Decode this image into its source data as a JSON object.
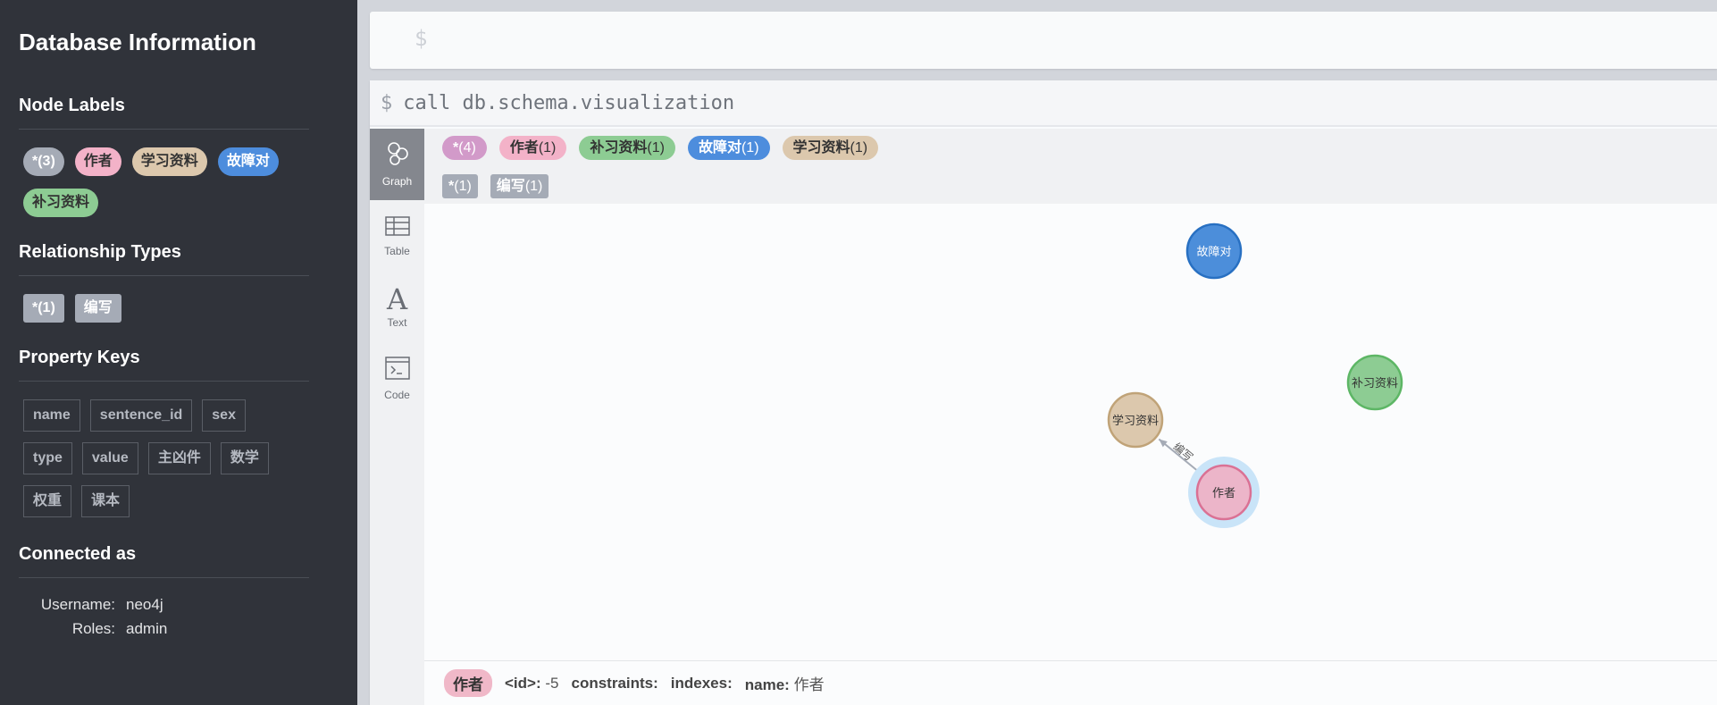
{
  "sidebar": {
    "title": "Database Information",
    "node_labels_title": "Node Labels",
    "node_labels": [
      {
        "label": "*(3)",
        "bg": "#a5abb6",
        "fg": "#ffffff"
      },
      {
        "label": "作者",
        "bg": "#f3b2c8",
        "fg": "#333333"
      },
      {
        "label": "学习资料",
        "bg": "#dcc8ad",
        "fg": "#333333"
      },
      {
        "label": "故障对",
        "bg": "#4d8ddd",
        "fg": "#ffffff"
      },
      {
        "label": "补习资料",
        "bg": "#8dcc93",
        "fg": "#333333"
      }
    ],
    "rel_types_title": "Relationship Types",
    "rel_types": [
      {
        "label": "*(1)"
      },
      {
        "label": "编写"
      }
    ],
    "property_keys_title": "Property Keys",
    "property_keys": [
      "name",
      "sentence_id",
      "sex",
      "type",
      "value",
      "主凶件",
      "数学",
      "权重",
      "课本"
    ],
    "connected_title": "Connected as",
    "username_label": "Username:",
    "username": "neo4j",
    "roles_label": "Roles:",
    "roles": "admin"
  },
  "editor": {
    "prompt": "$"
  },
  "frame": {
    "prompt": "$",
    "command": "call db.schema.visualization",
    "tabs": [
      {
        "label": "Graph",
        "icon": "graph-icon"
      },
      {
        "label": "Table",
        "icon": "table-icon"
      },
      {
        "label": "Text",
        "icon": "text-icon"
      },
      {
        "label": "Code",
        "icon": "code-icon"
      }
    ],
    "legend_nodes": [
      {
        "name": "*",
        "count": "(4)",
        "bg": "#d29ac9",
        "fg": "#ffffff"
      },
      {
        "name": "作者",
        "count": "(1)",
        "bg": "#f3b2c8",
        "fg": "#333333"
      },
      {
        "name": "补习资料",
        "count": "(1)",
        "bg": "#8dcc93",
        "fg": "#333333"
      },
      {
        "name": "故障对",
        "count": "(1)",
        "bg": "#4d8ddd",
        "fg": "#ffffff"
      },
      {
        "name": "学习资料",
        "count": "(1)",
        "bg": "#dcc8ad",
        "fg": "#333333"
      }
    ],
    "legend_rels": [
      {
        "name": "*",
        "count": "(1)"
      },
      {
        "name": "编写",
        "count": "(1)"
      }
    ],
    "graph": {
      "nodes": [
        {
          "label": "故障对",
          "fill": "#4c8eda",
          "stroke": "#2870c2",
          "text": "#ffffff"
        },
        {
          "label": "补习资料",
          "fill": "#8dcc93",
          "stroke": "#5db665",
          "text": "#333333"
        },
        {
          "label": "学习资料",
          "fill": "#dcc8ad",
          "stroke": "#c0a378",
          "text": "#333333"
        },
        {
          "label": "作者",
          "fill": "#ecb5c9",
          "stroke": "#da7194",
          "text": "#333333",
          "selected": true
        }
      ],
      "relationships": [
        {
          "label": "编写",
          "from": "作者",
          "to": "学习资料"
        }
      ]
    },
    "status": {
      "chip": "作者",
      "id_key": "<id>:",
      "id_val": "-5",
      "constraints_key": "constraints:",
      "indexes_key": "indexes:",
      "name_key": "name:",
      "name_val": "作者"
    }
  }
}
